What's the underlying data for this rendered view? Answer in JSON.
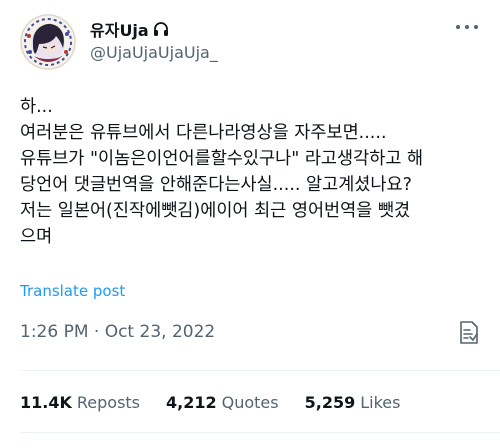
{
  "author": {
    "display_name": "유자Uja",
    "name_icon": "headphone-icon",
    "handle": "@UjaUjaUjaUja_"
  },
  "tweet": {
    "lines": [
      "하...",
      "여러분은 유튜브에서 다른나라영상을 자주보면.....",
      "유튜브가 \"이놈은이언어를할수있구나\" 라고생각하고 해",
      "당언어 댓글번역을 안해준다는사실..... 알고계셨나요?",
      "저는 일본어(진작에뺏김)에이어 최근 영어번역을 뺏겼",
      "으며"
    ],
    "translate_label": "Translate post",
    "timestamp": "1:26 PM · Oct 23, 2022"
  },
  "stats": [
    {
      "count": "11.4K",
      "label": "Reposts"
    },
    {
      "count": "4,212",
      "label": "Quotes"
    },
    {
      "count": "5,259",
      "label": "Likes"
    }
  ],
  "colors": {
    "text": "#0f1419",
    "secondary": "#536471",
    "link": "#1d9bf0",
    "divider": "#eff3f4"
  }
}
